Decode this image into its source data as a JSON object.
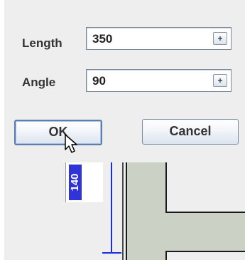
{
  "dialog": {
    "length": {
      "label": "Length",
      "value": "350",
      "spinner_glyph": "+"
    },
    "angle": {
      "label": "Angle",
      "value": "90",
      "spinner_glyph": "+"
    },
    "ok_label": "OK",
    "cancel_label": "Cancel"
  },
  "canvas": {
    "dimension_label": "140"
  },
  "colors": {
    "dimension_blue": "#2f33d8",
    "wall_fill": "#ccd1c6",
    "dialog_background": "#eeeeee"
  },
  "icons": {
    "cursor": "arrow-pointer-icon",
    "spinner": "spinner-plus-icon"
  }
}
